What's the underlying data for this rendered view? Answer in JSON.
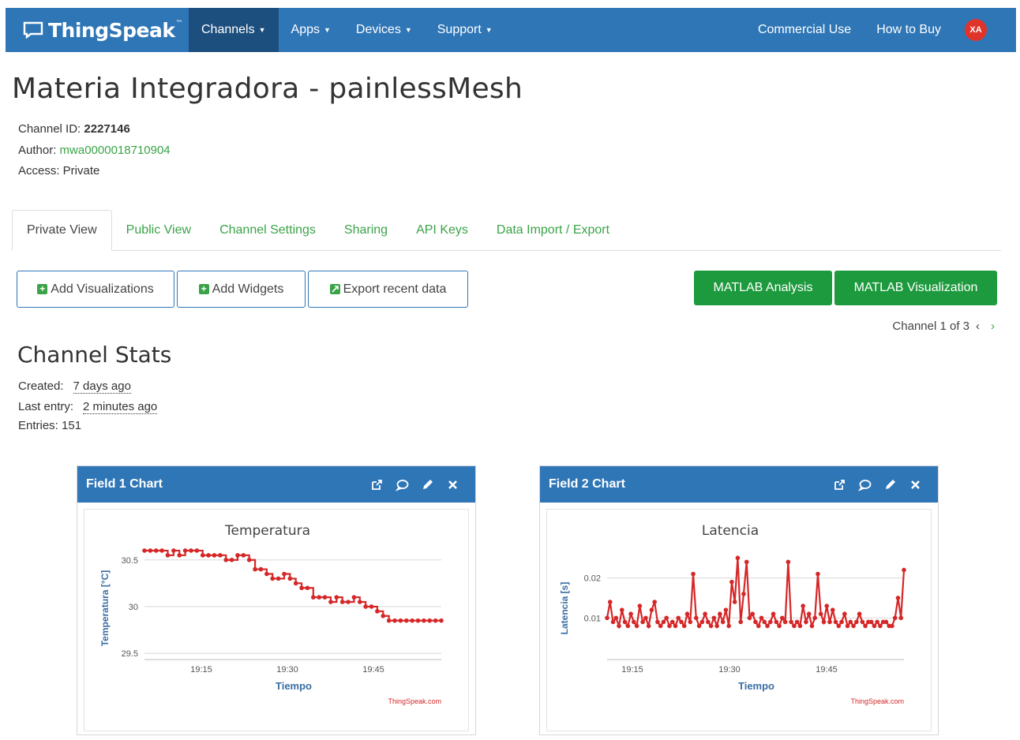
{
  "nav": {
    "brand": "ThingSpeak",
    "tm": "™",
    "items": [
      {
        "label": "Channels",
        "active": true
      },
      {
        "label": "Apps",
        "active": false
      },
      {
        "label": "Devices",
        "active": false
      },
      {
        "label": "Support",
        "active": false
      }
    ],
    "commercial": "Commercial Use",
    "how_to_buy": "How to Buy",
    "avatar": "XA"
  },
  "channel": {
    "title": "Materia Integradora - painlessMesh",
    "id_label": "Channel ID: ",
    "id": "2227146",
    "author_label": "Author: ",
    "author": "mwa0000018710904",
    "access": "Access: Private"
  },
  "tabs": [
    "Private View",
    "Public View",
    "Channel Settings",
    "Sharing",
    "API Keys",
    "Data Import / Export"
  ],
  "buttons": {
    "add_vis": "Add Visualizations",
    "add_widgets": "Add Widgets",
    "export": "Export recent data",
    "matlab_analysis": "MATLAB Analysis",
    "matlab_vis": "MATLAB Visualization"
  },
  "pager": {
    "text": "Channel 1 of 3",
    "prev": "‹",
    "next": "›"
  },
  "stats": {
    "title": "Channel Stats",
    "created_label": "Created:",
    "created": "7 days ago",
    "last_label": "Last entry:",
    "last": "2 minutes ago",
    "entries": "Entries: 151"
  },
  "colors": {
    "nav": "#2f76b7",
    "nav_active": "#1d4f7e",
    "green": "#1e9a3e",
    "link": "#3aa348",
    "series": "#d62728"
  },
  "chart_data": [
    {
      "panel_title": "Field 1 Chart",
      "type": "line",
      "title": "Temperatura",
      "xlabel": "Tiempo",
      "ylabel": "Temperatura [°C]",
      "credit": "ThingSpeak.com",
      "x_ticks": [
        "19:15",
        "19:30",
        "19:45"
      ],
      "y_ticks": [
        "29.5",
        "30",
        "30.5"
      ],
      "ylim": [
        29.45,
        30.65
      ],
      "xlim": [
        0,
        52
      ],
      "grid": true,
      "values": [
        30.6,
        30.6,
        30.6,
        30.6,
        30.55,
        30.6,
        30.55,
        30.6,
        30.6,
        30.6,
        30.55,
        30.55,
        30.55,
        30.55,
        30.5,
        30.5,
        30.55,
        30.55,
        30.5,
        30.4,
        30.4,
        30.35,
        30.3,
        30.3,
        30.35,
        30.3,
        30.25,
        30.2,
        30.2,
        30.1,
        30.1,
        30.1,
        30.05,
        30.1,
        30.05,
        30.05,
        30.1,
        30.05,
        30.0,
        30.0,
        29.95,
        29.9,
        29.85,
        29.85,
        29.85,
        29.85,
        29.85,
        29.85,
        29.85,
        29.85,
        29.85,
        29.85
      ]
    },
    {
      "panel_title": "Field 2 Chart",
      "type": "line",
      "title": "Latencia",
      "xlabel": "Tiempo",
      "ylabel": "Latencia [s]",
      "credit": "ThingSpeak.com",
      "x_ticks": [
        "19:15",
        "19:30",
        "19:45"
      ],
      "y_ticks": [
        "0.01",
        "0.02"
      ],
      "ylim": [
        0.0,
        0.028
      ],
      "xlim": [
        0,
        100
      ],
      "grid": true,
      "values": [
        0.01,
        0.014,
        0.009,
        0.01,
        0.008,
        0.012,
        0.009,
        0.008,
        0.011,
        0.009,
        0.008,
        0.013,
        0.009,
        0.01,
        0.008,
        0.012,
        0.014,
        0.009,
        0.008,
        0.009,
        0.01,
        0.008,
        0.009,
        0.008,
        0.01,
        0.009,
        0.008,
        0.011,
        0.009,
        0.021,
        0.01,
        0.008,
        0.009,
        0.011,
        0.009,
        0.008,
        0.01,
        0.008,
        0.011,
        0.009,
        0.012,
        0.008,
        0.019,
        0.014,
        0.025,
        0.009,
        0.016,
        0.024,
        0.01,
        0.011,
        0.009,
        0.008,
        0.01,
        0.009,
        0.008,
        0.009,
        0.011,
        0.009,
        0.008,
        0.01,
        0.009,
        0.024,
        0.009,
        0.008,
        0.009,
        0.008,
        0.013,
        0.009,
        0.011,
        0.008,
        0.01,
        0.021,
        0.011,
        0.009,
        0.013,
        0.009,
        0.012,
        0.009,
        0.008,
        0.009,
        0.011,
        0.008,
        0.009,
        0.008,
        0.009,
        0.011,
        0.009,
        0.008,
        0.009,
        0.009,
        0.008,
        0.009,
        0.008,
        0.009,
        0.009,
        0.008,
        0.008,
        0.01,
        0.015,
        0.01,
        0.022
      ]
    }
  ]
}
